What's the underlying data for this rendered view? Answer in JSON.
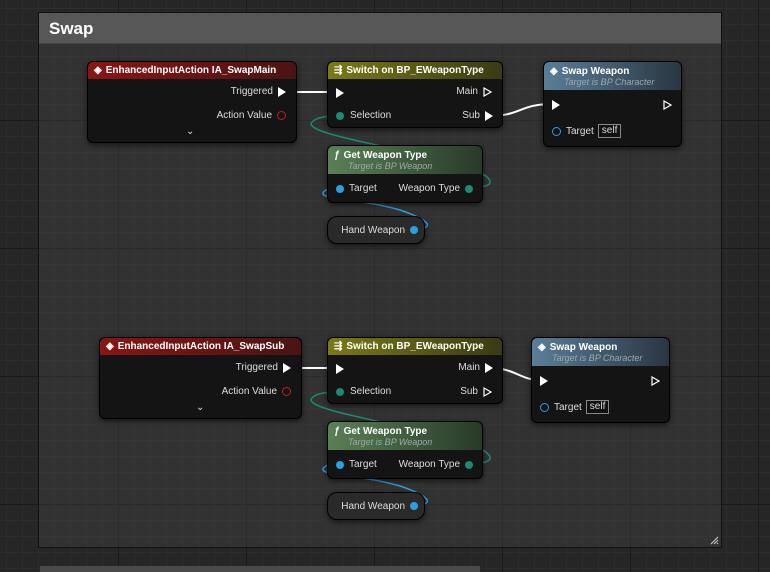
{
  "comment": {
    "title": "Swap"
  },
  "groups": [
    {
      "event": {
        "title": "EnhancedInputAction IA_SwapMain",
        "triggered": "Triggered",
        "action_value": "Action Value"
      },
      "switch": {
        "title": "Switch on BP_EWeaponType",
        "selection": "Selection",
        "main": "Main",
        "sub": "Sub"
      },
      "swap": {
        "title": "Swap Weapon",
        "subtitle": "Target is BP Character",
        "target": "Target",
        "target_value": "self"
      },
      "get": {
        "title": "Get Weapon Type",
        "subtitle": "Target is BP Weapon",
        "target": "Target",
        "output": "Weapon Type"
      },
      "var": {
        "label": "Hand Weapon"
      }
    },
    {
      "event": {
        "title": "EnhancedInputAction IA_SwapSub",
        "triggered": "Triggered",
        "action_value": "Action Value"
      },
      "switch": {
        "title": "Switch on BP_EWeaponType",
        "selection": "Selection",
        "main": "Main",
        "sub": "Sub"
      },
      "swap": {
        "title": "Swap Weapon",
        "subtitle": "Target is BP Character",
        "target": "Target",
        "target_value": "self"
      },
      "get": {
        "title": "Get Weapon Type",
        "subtitle": "Target is BP Weapon",
        "target": "Target",
        "output": "Weapon Type"
      },
      "var": {
        "label": "Hand Weapon"
      }
    }
  ],
  "icons": {
    "event": "event-diamond-icon",
    "switch": "switch-icon",
    "function": "function-icon",
    "expand": "chevron-down-icon"
  },
  "colors": {
    "exec_wire": "#ffffff",
    "object_wire": "#2aa0e0",
    "enum_wire": "#1a8a72",
    "event_header": "#8a1515",
    "switch_header": "#7a7a16",
    "call_header": "#5a7e98",
    "pure_header": "#5a8057"
  }
}
